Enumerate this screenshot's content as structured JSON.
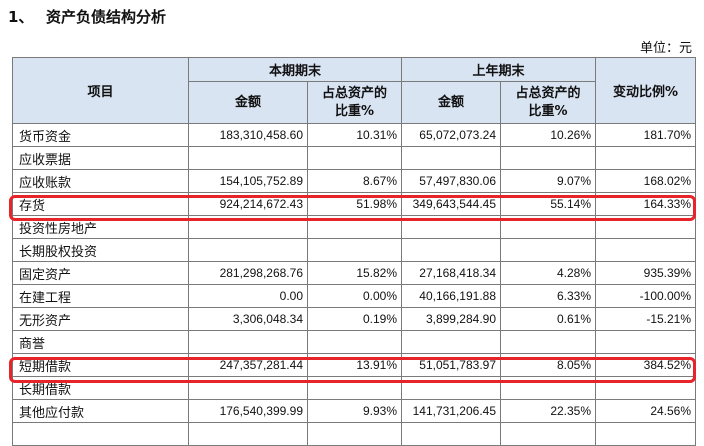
{
  "heading": {
    "number": "1、",
    "title": "资产负债结构分析"
  },
  "unit": "单位：元",
  "columns": {
    "item": "项目",
    "current_period": "本期期末",
    "prior_period": "上年期末",
    "amount": "金额",
    "ratio_line1": "占总资产的",
    "ratio_line2": "比重%",
    "change": "变动比例%"
  },
  "rows": [
    {
      "name": "货币资金",
      "cur_amount": "183,310,458.60",
      "cur_ratio": "10.31%",
      "prev_amount": "65,072,073.24",
      "prev_ratio": "10.26%",
      "change": "181.70%"
    },
    {
      "name": "应收票据",
      "cur_amount": "",
      "cur_ratio": "",
      "prev_amount": "",
      "prev_ratio": "",
      "change": ""
    },
    {
      "name": "应收账款",
      "cur_amount": "154,105,752.89",
      "cur_ratio": "8.67%",
      "prev_amount": "57,497,830.06",
      "prev_ratio": "9.07%",
      "change": "168.02%"
    },
    {
      "name": "存货",
      "cur_amount": "924,214,672.43",
      "cur_ratio": "51.98%",
      "prev_amount": "349,643,544.45",
      "prev_ratio": "55.14%",
      "change": "164.33%"
    },
    {
      "name": "投资性房地产",
      "cur_amount": "",
      "cur_ratio": "",
      "prev_amount": "",
      "prev_ratio": "",
      "change": ""
    },
    {
      "name": "长期股权投资",
      "cur_amount": "",
      "cur_ratio": "",
      "prev_amount": "",
      "prev_ratio": "",
      "change": ""
    },
    {
      "name": "固定资产",
      "cur_amount": "281,298,268.76",
      "cur_ratio": "15.82%",
      "prev_amount": "27,168,418.34",
      "prev_ratio": "4.28%",
      "change": "935.39%"
    },
    {
      "name": "在建工程",
      "cur_amount": "0.00",
      "cur_ratio": "0.00%",
      "prev_amount": "40,166,191.88",
      "prev_ratio": "6.33%",
      "change": "-100.00%"
    },
    {
      "name": "无形资产",
      "cur_amount": "3,306,048.34",
      "cur_ratio": "0.19%",
      "prev_amount": "3,899,284.90",
      "prev_ratio": "0.61%",
      "change": "-15.21%"
    },
    {
      "name": "商誉",
      "cur_amount": "",
      "cur_ratio": "",
      "prev_amount": "",
      "prev_ratio": "",
      "change": ""
    },
    {
      "name": "短期借款",
      "cur_amount": "247,357,281.44",
      "cur_ratio": "13.91%",
      "prev_amount": "51,051,783.97",
      "prev_ratio": "8.05%",
      "change": "384.52%"
    },
    {
      "name": "长期借款",
      "cur_amount": "",
      "cur_ratio": "",
      "prev_amount": "",
      "prev_ratio": "",
      "change": ""
    },
    {
      "name": "其他应付款",
      "cur_amount": "176,540,399.99",
      "cur_ratio": "9.93%",
      "prev_amount": "141,731,206.45",
      "prev_ratio": "22.35%",
      "change": "24.56%"
    },
    {
      "name": "",
      "cur_amount": "",
      "cur_ratio": "",
      "prev_amount": "",
      "prev_ratio": "",
      "change": ""
    }
  ],
  "highlight_color": "#e6242a"
}
